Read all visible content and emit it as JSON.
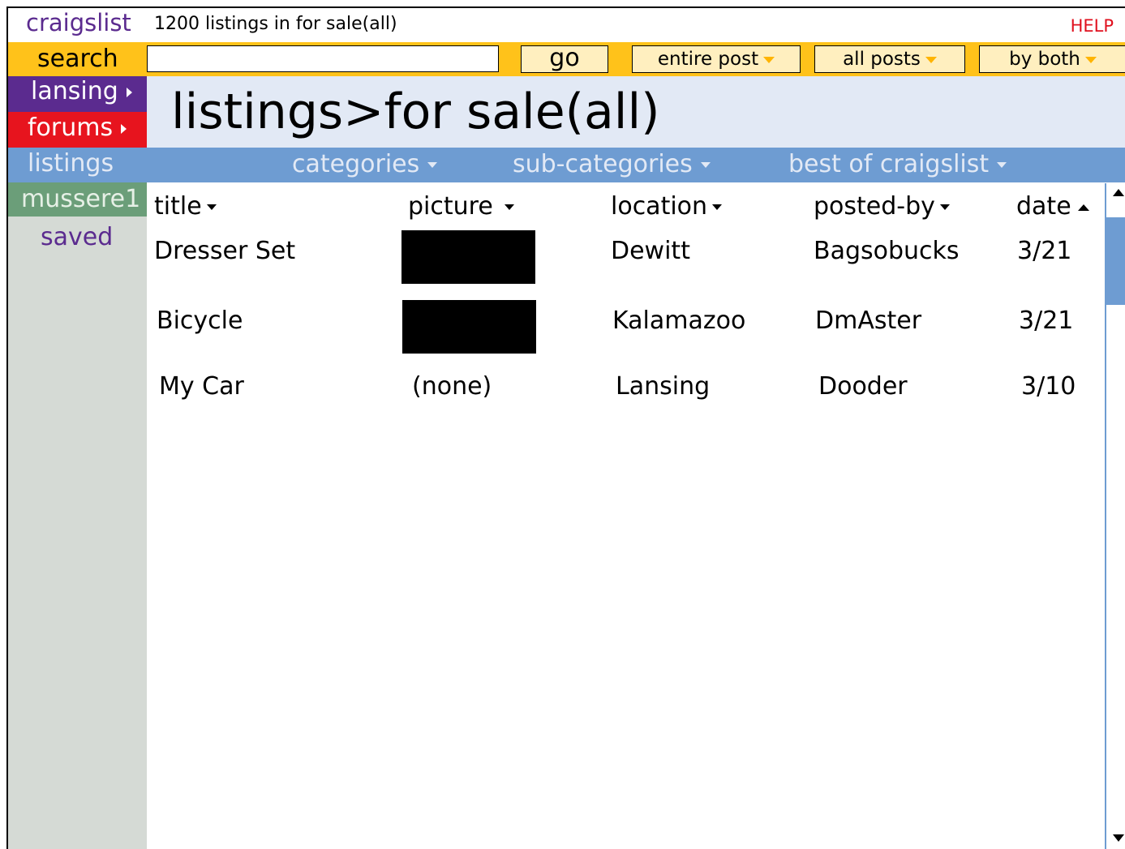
{
  "topbar": {
    "brand": "craigslist",
    "count": "1200 listings in for sale(all)",
    "help": "HELP"
  },
  "searchbar": {
    "label": "search",
    "input_value": "",
    "go": "go",
    "scope": "entire post",
    "filter": "all posts",
    "sort": "by both"
  },
  "nav": {
    "city": "lansing",
    "forums": "forums",
    "listings": "listings",
    "user": "mussere1",
    "saved": "saved"
  },
  "header": {
    "title": "listings>for sale(all)"
  },
  "menubar": {
    "categories": "categories",
    "subcategories": "sub-categories",
    "best": "best of craigslist"
  },
  "table": {
    "columns": [
      "title",
      "picture",
      "location",
      "posted-by",
      "date"
    ],
    "rows": [
      {
        "title": "Dresser Set",
        "picture": "",
        "location": "Dewitt",
        "posted_by": "Bagsobucks",
        "date": "3/21"
      },
      {
        "title": "Bicycle",
        "picture": "",
        "location": "Kalamazoo",
        "posted_by": "DmAster",
        "date": "3/21"
      },
      {
        "title": "My Car",
        "picture": "(none)",
        "location": "Lansing",
        "posted_by": "Dooder",
        "date": "3/10"
      }
    ]
  },
  "colors": {
    "purple": "#5b2b8f",
    "red": "#e7141e",
    "yellow": "#ffc21a",
    "blue": "#6e9cd2",
    "green": "#6b9e79",
    "light_blue": "#e2e9f5",
    "gray": "#d5dad5"
  },
  "icons": {
    "nav_arrow": "triangle-right-icon",
    "dropdown": "caret-down-icon",
    "sort_asc": "caret-up-icon"
  }
}
